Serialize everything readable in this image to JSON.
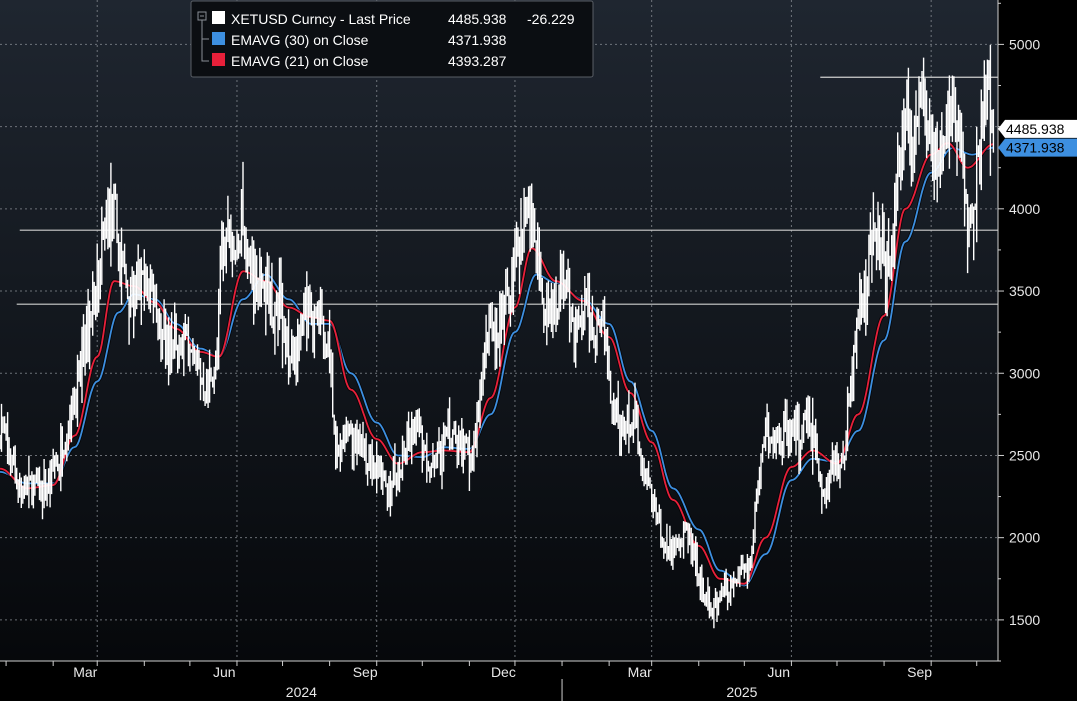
{
  "chart_data": {
    "type": "line",
    "title": "",
    "xlabel": "",
    "ylabel": "",
    "ylim": [
      1250,
      5270
    ],
    "yticks": [
      1500,
      2000,
      2500,
      3000,
      3500,
      4000,
      5000
    ],
    "grid": true,
    "legend_position": "top-left",
    "colors": {
      "background": "#000000",
      "plot_bg_top": "#1f2630",
      "plot_bg_bottom": "#06080b",
      "price": "#ffffff",
      "ema30": "#3d8fe0",
      "ema21": "#e8203a",
      "grid": "#8a8f96",
      "hline": "#cfcfcf"
    },
    "x_ticks": [
      {
        "label": "Mar",
        "date": "2024-03-01"
      },
      {
        "label": "Jun",
        "date": "2024-06-01"
      },
      {
        "label": "Sep",
        "date": "2024-09-01"
      },
      {
        "label": "Dec",
        "date": "2024-12-01"
      },
      {
        "label": "Mar",
        "date": "2025-03-01"
      },
      {
        "label": "Jun",
        "date": "2025-06-01"
      },
      {
        "label": "Sep",
        "date": "2025-09-01"
      }
    ],
    "year_labels": [
      {
        "label": "2024",
        "date": "2024-07-15"
      },
      {
        "label": "2025",
        "date": "2025-05-01"
      }
    ],
    "year_separator_date": "2025-01-01",
    "x_range": [
      "2023-12-28",
      "2025-10-15"
    ],
    "legend": [
      {
        "name": "XETUSD Curncy - Last Price",
        "value": "4485.938",
        "change": "-26.229",
        "color": "#ffffff"
      },
      {
        "name": "EMAVG (30)  on Close",
        "value": "4371.938",
        "color": "#3d8fe0"
      },
      {
        "name": "EMAVG (21)  on Close",
        "value": "4393.287",
        "color": "#e8203a"
      }
    ],
    "value_tags": [
      {
        "label": "4485.938",
        "value": 4485.938,
        "bg": "#ffffff",
        "fg": "#000000"
      },
      {
        "label": "4371.938",
        "value": 4371.938,
        "bg": "#3d8fe0",
        "fg": "#000000"
      }
    ],
    "hlines": [
      {
        "value": 4800,
        "from": "2025-06-20",
        "to": "2025-10-15"
      },
      {
        "value": 3870,
        "from": "2024-01-10",
        "to": "2025-10-15"
      },
      {
        "value": 3420,
        "from": "2024-01-08",
        "to": "2025-10-15"
      }
    ],
    "series": [
      {
        "name": "XETUSD Curncy - Last Price",
        "kind": "price",
        "points": [
          [
            "2023-12-28",
            2700
          ],
          [
            "2024-01-05",
            2450
          ],
          [
            "2024-01-12",
            2280
          ],
          [
            "2024-01-20",
            2320
          ],
          [
            "2024-01-27",
            2300
          ],
          [
            "2024-02-03",
            2450
          ],
          [
            "2024-02-10",
            2650
          ],
          [
            "2024-02-17",
            2950
          ],
          [
            "2024-02-24",
            3300
          ],
          [
            "2024-03-02",
            3600
          ],
          [
            "2024-03-06",
            3900
          ],
          [
            "2024-03-12",
            4000
          ],
          [
            "2024-03-16",
            3700
          ],
          [
            "2024-03-23",
            3450
          ],
          [
            "2024-03-30",
            3520
          ],
          [
            "2024-04-06",
            3500
          ],
          [
            "2024-04-13",
            3250
          ],
          [
            "2024-04-20",
            3100
          ],
          [
            "2024-04-27",
            3180
          ],
          [
            "2024-05-04",
            3050
          ],
          [
            "2024-05-11",
            2950
          ],
          [
            "2024-05-18",
            3050
          ],
          [
            "2024-05-22",
            3700
          ],
          [
            "2024-05-27",
            3850
          ],
          [
            "2024-06-05",
            3800
          ],
          [
            "2024-06-12",
            3600
          ],
          [
            "2024-06-19",
            3550
          ],
          [
            "2024-06-26",
            3400
          ],
          [
            "2024-07-03",
            3200
          ],
          [
            "2024-07-10",
            3100
          ],
          [
            "2024-07-17",
            3450
          ],
          [
            "2024-07-24",
            3300
          ],
          [
            "2024-07-31",
            3200
          ],
          [
            "2024-08-05",
            2500
          ],
          [
            "2024-08-12",
            2700
          ],
          [
            "2024-08-19",
            2600
          ],
          [
            "2024-08-26",
            2500
          ],
          [
            "2024-09-02",
            2400
          ],
          [
            "2024-09-07",
            2300
          ],
          [
            "2024-09-14",
            2400
          ],
          [
            "2024-09-21",
            2550
          ],
          [
            "2024-09-28",
            2650
          ],
          [
            "2024-10-05",
            2450
          ],
          [
            "2024-10-12",
            2500
          ],
          [
            "2024-10-19",
            2650
          ],
          [
            "2024-10-26",
            2550
          ],
          [
            "2024-11-02",
            2480
          ],
          [
            "2024-11-09",
            2900
          ],
          [
            "2024-11-12",
            3300
          ],
          [
            "2024-11-19",
            3200
          ],
          [
            "2024-11-26",
            3500
          ],
          [
            "2024-12-03",
            3700
          ],
          [
            "2024-12-08",
            3950
          ],
          [
            "2024-12-14",
            3850
          ],
          [
            "2024-12-20",
            3400
          ],
          [
            "2024-12-27",
            3350
          ],
          [
            "2025-01-03",
            3600
          ],
          [
            "2025-01-10",
            3250
          ],
          [
            "2025-01-17",
            3350
          ],
          [
            "2025-01-24",
            3300
          ],
          [
            "2025-01-31",
            3200
          ],
          [
            "2025-02-03",
            2800
          ],
          [
            "2025-02-10",
            2650
          ],
          [
            "2025-02-17",
            2700
          ],
          [
            "2025-02-24",
            2400
          ],
          [
            "2025-03-03",
            2200
          ],
          [
            "2025-03-10",
            1950
          ],
          [
            "2025-03-17",
            1950
          ],
          [
            "2025-03-24",
            2050
          ],
          [
            "2025-03-31",
            1820
          ],
          [
            "2025-04-07",
            1550
          ],
          [
            "2025-04-14",
            1600
          ],
          [
            "2025-04-21",
            1700
          ],
          [
            "2025-04-28",
            1800
          ],
          [
            "2025-05-05",
            1820
          ],
          [
            "2025-05-09",
            2300
          ],
          [
            "2025-05-14",
            2600
          ],
          [
            "2025-05-21",
            2550
          ],
          [
            "2025-05-28",
            2650
          ],
          [
            "2025-06-04",
            2600
          ],
          [
            "2025-06-11",
            2750
          ],
          [
            "2025-06-18",
            2450
          ],
          [
            "2025-06-22",
            2250
          ],
          [
            "2025-06-29",
            2450
          ],
          [
            "2025-07-06",
            2550
          ],
          [
            "2025-07-10",
            2950
          ],
          [
            "2025-07-16",
            3400
          ],
          [
            "2025-07-22",
            3700
          ],
          [
            "2025-07-29",
            3800
          ],
          [
            "2025-08-05",
            3650
          ],
          [
            "2025-08-11",
            4300
          ],
          [
            "2025-08-16",
            4700
          ],
          [
            "2025-08-19",
            4300
          ],
          [
            "2025-08-25",
            4800
          ],
          [
            "2025-08-30",
            4400
          ],
          [
            "2025-09-06",
            4350
          ],
          [
            "2025-09-13",
            4650
          ],
          [
            "2025-09-20",
            4500
          ],
          [
            "2025-09-25",
            3900
          ],
          [
            "2025-09-30",
            4150
          ],
          [
            "2025-10-04",
            4500
          ],
          [
            "2025-10-08",
            4700
          ],
          [
            "2025-10-12",
            4485.938
          ]
        ]
      },
      {
        "name": "EMAVG (30)  on Close",
        "kind": "ema30",
        "points": [
          [
            "2023-12-28",
            2400
          ],
          [
            "2024-01-15",
            2330
          ],
          [
            "2024-02-01",
            2330
          ],
          [
            "2024-02-15",
            2550
          ],
          [
            "2024-03-01",
            2950
          ],
          [
            "2024-03-15",
            3370
          ],
          [
            "2024-03-25",
            3480
          ],
          [
            "2024-04-08",
            3450
          ],
          [
            "2024-04-22",
            3300
          ],
          [
            "2024-05-08",
            3150
          ],
          [
            "2024-05-20",
            3100
          ],
          [
            "2024-06-05",
            3450
          ],
          [
            "2024-06-20",
            3600
          ],
          [
            "2024-07-05",
            3450
          ],
          [
            "2024-07-20",
            3300
          ],
          [
            "2024-08-01",
            3300
          ],
          [
            "2024-08-15",
            3000
          ],
          [
            "2024-09-01",
            2700
          ],
          [
            "2024-09-15",
            2500
          ],
          [
            "2024-10-01",
            2490
          ],
          [
            "2024-10-15",
            2550
          ],
          [
            "2024-11-01",
            2540
          ],
          [
            "2024-11-15",
            2750
          ],
          [
            "2024-12-01",
            3250
          ],
          [
            "2024-12-15",
            3600
          ],
          [
            "2024-12-28",
            3550
          ],
          [
            "2025-01-15",
            3450
          ],
          [
            "2025-02-01",
            3300
          ],
          [
            "2025-02-15",
            2950
          ],
          [
            "2025-03-01",
            2650
          ],
          [
            "2025-03-15",
            2300
          ],
          [
            "2025-04-01",
            2050
          ],
          [
            "2025-04-15",
            1800
          ],
          [
            "2025-05-01",
            1710
          ],
          [
            "2025-05-15",
            1900
          ],
          [
            "2025-06-01",
            2350
          ],
          [
            "2025-06-15",
            2480
          ],
          [
            "2025-07-01",
            2460
          ],
          [
            "2025-07-15",
            2650
          ],
          [
            "2025-08-01",
            3200
          ],
          [
            "2025-08-15",
            3800
          ],
          [
            "2025-09-01",
            4220
          ],
          [
            "2025-09-15",
            4370
          ],
          [
            "2025-09-28",
            4330
          ],
          [
            "2025-10-12",
            4371.938
          ]
        ]
      },
      {
        "name": "EMAVG (21)  on Close",
        "kind": "ema21",
        "points": [
          [
            "2023-12-28",
            2420
          ],
          [
            "2024-01-15",
            2300
          ],
          [
            "2024-02-01",
            2320
          ],
          [
            "2024-02-15",
            2620
          ],
          [
            "2024-03-01",
            3100
          ],
          [
            "2024-03-12",
            3560
          ],
          [
            "2024-03-25",
            3530
          ],
          [
            "2024-04-08",
            3430
          ],
          [
            "2024-04-22",
            3270
          ],
          [
            "2024-05-08",
            3130
          ],
          [
            "2024-05-20",
            3100
          ],
          [
            "2024-06-05",
            3620
          ],
          [
            "2024-06-20",
            3560
          ],
          [
            "2024-07-05",
            3400
          ],
          [
            "2024-07-20",
            3340
          ],
          [
            "2024-08-01",
            3320
          ],
          [
            "2024-08-15",
            2900
          ],
          [
            "2024-09-01",
            2600
          ],
          [
            "2024-09-15",
            2450
          ],
          [
            "2024-10-01",
            2520
          ],
          [
            "2024-10-15",
            2530
          ],
          [
            "2024-11-01",
            2520
          ],
          [
            "2024-11-15",
            2850
          ],
          [
            "2024-12-01",
            3400
          ],
          [
            "2024-12-12",
            3760
          ],
          [
            "2024-12-28",
            3560
          ],
          [
            "2025-01-15",
            3440
          ],
          [
            "2025-02-01",
            3220
          ],
          [
            "2025-02-15",
            2880
          ],
          [
            "2025-03-01",
            2580
          ],
          [
            "2025-03-15",
            2230
          ],
          [
            "2025-04-01",
            1950
          ],
          [
            "2025-04-15",
            1750
          ],
          [
            "2025-05-01",
            1720
          ],
          [
            "2025-05-15",
            2000
          ],
          [
            "2025-06-01",
            2430
          ],
          [
            "2025-06-15",
            2530
          ],
          [
            "2025-07-01",
            2450
          ],
          [
            "2025-07-15",
            2750
          ],
          [
            "2025-08-01",
            3350
          ],
          [
            "2025-08-15",
            4000
          ],
          [
            "2025-09-01",
            4330
          ],
          [
            "2025-09-12",
            4400
          ],
          [
            "2025-09-25",
            4250
          ],
          [
            "2025-10-12",
            4393.287
          ]
        ]
      }
    ]
  }
}
